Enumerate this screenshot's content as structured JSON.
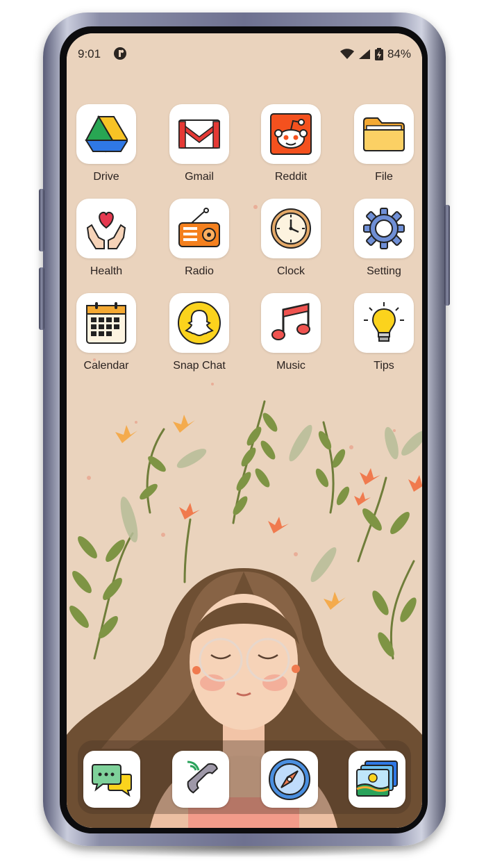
{
  "status_bar": {
    "time": "9:01",
    "battery": "84%",
    "icons": [
      "notification-icon",
      "wifi-icon",
      "signal-icon",
      "battery-icon"
    ]
  },
  "apps": [
    {
      "label": "Drive",
      "icon": "google-drive-icon"
    },
    {
      "label": "Gmail",
      "icon": "gmail-icon"
    },
    {
      "label": "Reddit",
      "icon": "reddit-icon"
    },
    {
      "label": "File",
      "icon": "folder-icon"
    },
    {
      "label": "Health",
      "icon": "health-icon"
    },
    {
      "label": "Radio",
      "icon": "radio-icon"
    },
    {
      "label": "Clock",
      "icon": "clock-icon"
    },
    {
      "label": "Setting",
      "icon": "gear-icon"
    },
    {
      "label": "Calendar",
      "icon": "calendar-icon"
    },
    {
      "label": "Snap Chat",
      "icon": "snapchat-icon"
    },
    {
      "label": "Music",
      "icon": "music-icon"
    },
    {
      "label": "Tips",
      "icon": "lightbulb-icon"
    }
  ],
  "dock": [
    {
      "icon": "messages-icon"
    },
    {
      "icon": "phone-icon"
    },
    {
      "icon": "compass-icon"
    },
    {
      "icon": "gallery-icon"
    }
  ],
  "colors": {
    "wallpaper": "#ead3bd",
    "frame": "#6e7190",
    "accent_orange": "#f07a4e",
    "leaf_green": "#7e9444"
  }
}
